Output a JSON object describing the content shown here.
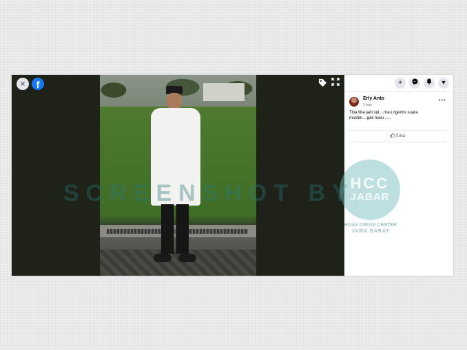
{
  "viewer": {
    "close_icon": "×",
    "fb_logo": "f",
    "tag_icon": "tag-icon",
    "expand_icon": "expand-icon"
  },
  "panel": {
    "buttons": [
      "+",
      "✆",
      "🔔",
      "▾"
    ],
    "post": {
      "author": "Erly Anto",
      "time": "1 hari",
      "more": "•••",
      "text": "Tiba tiba jadi spt....mau ngemis suara muslim....gak malu .....",
      "like_label": "Suka"
    }
  },
  "watermark": {
    "text": "SCREENSHOT BY",
    "logo_line1": "HCC",
    "logo_line2": "JABAR",
    "subtitle_line1": "HOAX CRISIS CENTER",
    "subtitle_line2": "JAWA BARAT"
  },
  "colors": {
    "facebook_blue": "#1877f2",
    "watermark_teal": "#2a7878"
  }
}
